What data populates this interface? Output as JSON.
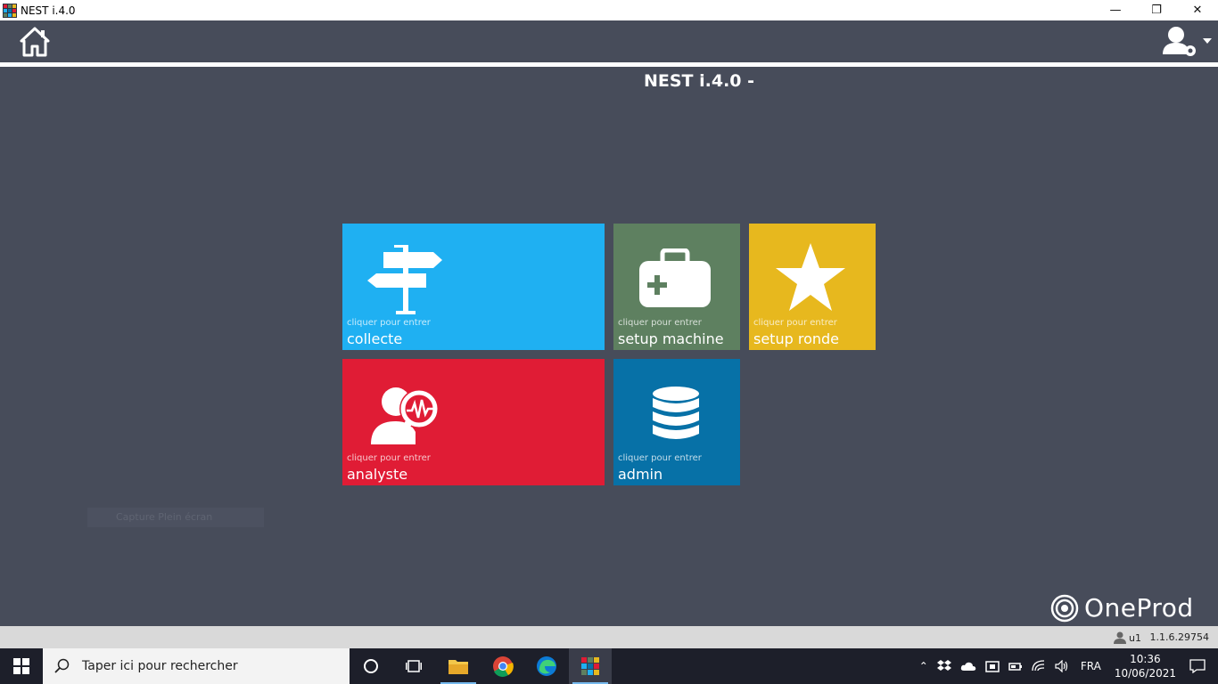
{
  "window": {
    "title": "NEST i.4.0",
    "minimize": "—",
    "restore": "❐",
    "close": "✕"
  },
  "header": {
    "home_icon": "home-icon",
    "user_icon": "user-settings-icon"
  },
  "page": {
    "title": "NEST i.4.0 -"
  },
  "tiles": [
    {
      "id": "collecte",
      "sub": "cliquer pour entrer",
      "label": "collecte",
      "color": "#1fb0f2",
      "icon": "signpost-icon"
    },
    {
      "id": "setup-machine",
      "sub": "cliquer pour entrer",
      "label": "setup machine",
      "color": "#5e8060",
      "icon": "medical-kit-icon"
    },
    {
      "id": "setup-ronde",
      "sub": "cliquer pour entrer",
      "label": "setup ronde",
      "color": "#e7b81e",
      "icon": "star-icon"
    },
    {
      "id": "analyste",
      "sub": "cliquer pour entrer",
      "label": "analyste",
      "color": "#e01c35",
      "icon": "analyst-search-icon"
    },
    {
      "id": "admin",
      "sub": "cliquer pour entrer",
      "label": "admin",
      "color": "#0771a7",
      "icon": "database-icon"
    }
  ],
  "ghost_text": "Capture Plein écran",
  "logo": {
    "text": "OneProd"
  },
  "statusbar": {
    "user": "u1",
    "version": "1.1.6.29754"
  },
  "taskbar": {
    "search_placeholder": "Taper ici pour rechercher",
    "language": "FRA",
    "time": "10:36",
    "date": "10/06/2021"
  }
}
